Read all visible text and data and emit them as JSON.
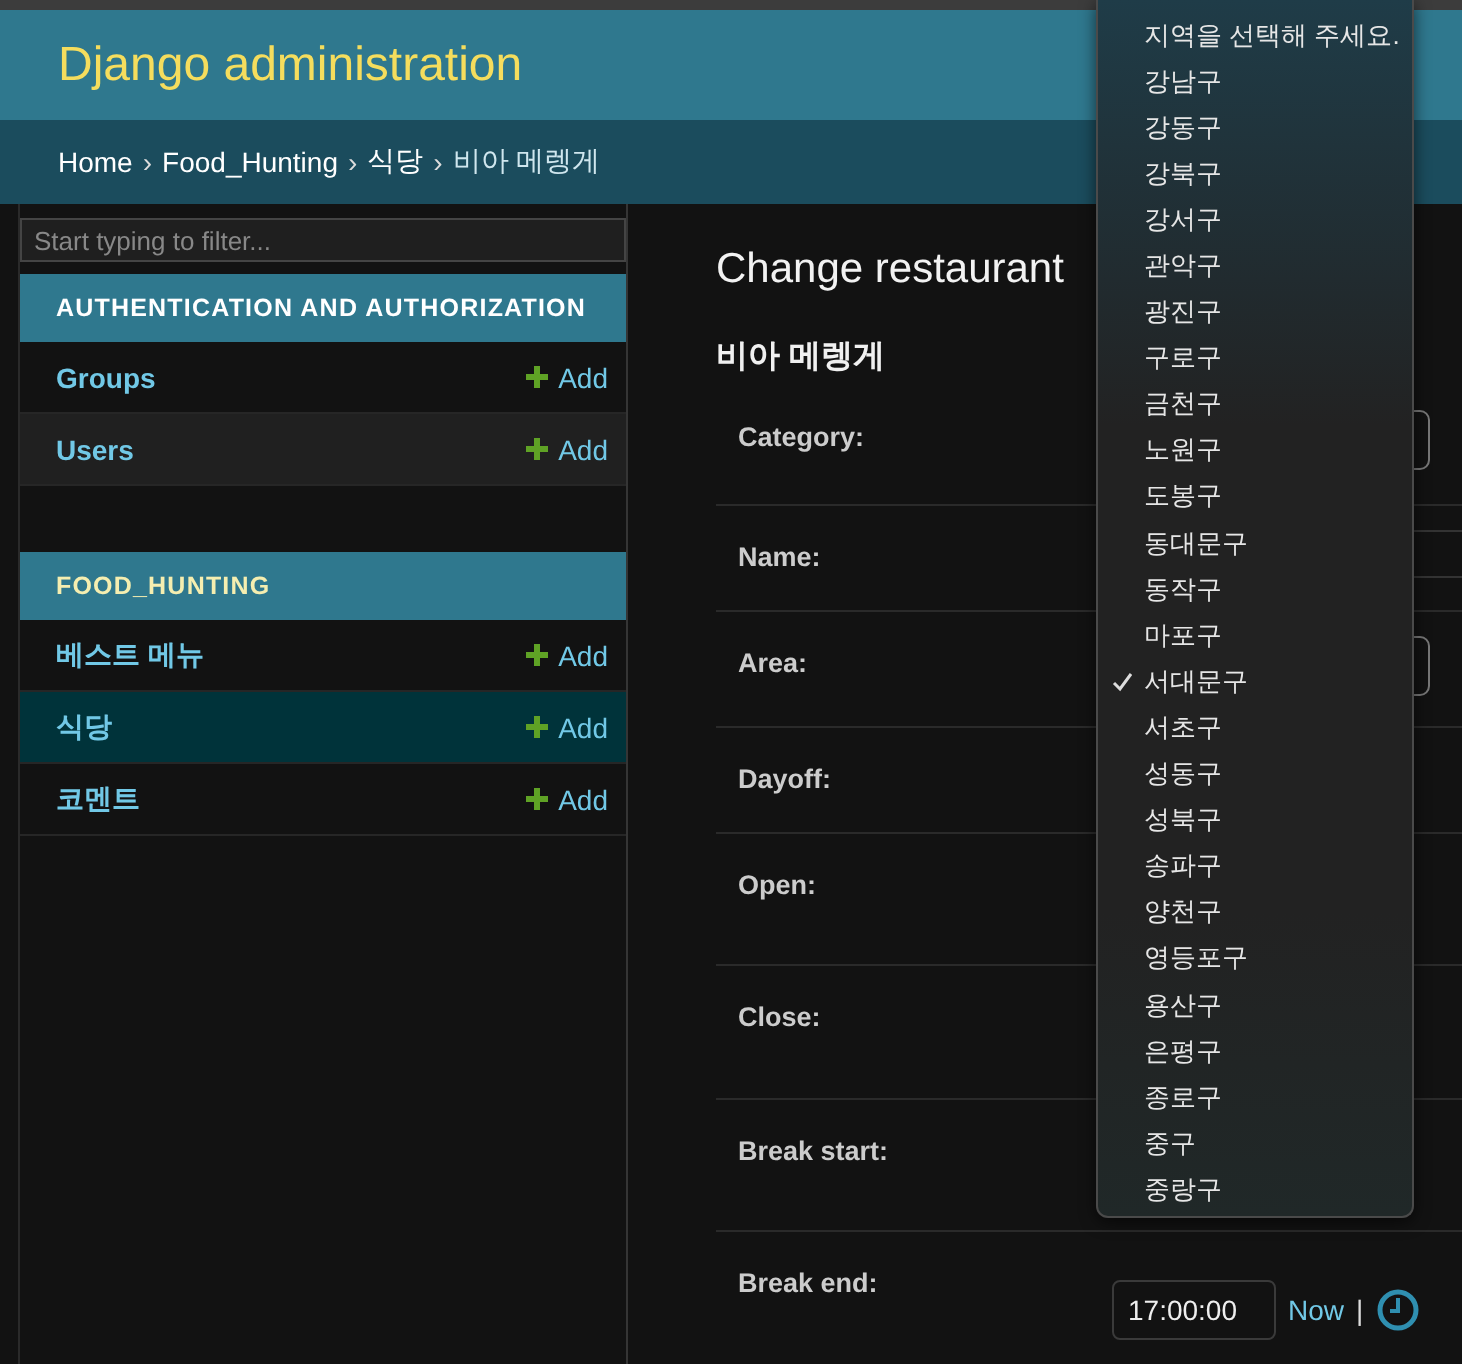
{
  "header": {
    "title": "Django administration"
  },
  "breadcrumbs": {
    "separator": "›",
    "items": [
      {
        "label": "Home",
        "current": false
      },
      {
        "label": "Food_Hunting",
        "current": false
      },
      {
        "label": "식당",
        "current": false
      },
      {
        "label": "비아 메렝게",
        "current": true
      }
    ]
  },
  "sidebar": {
    "filter_placeholder": "Start typing to filter...",
    "modules": [
      {
        "title": "AUTHENTICATION AND AUTHORIZATION",
        "highlight": false,
        "items": [
          {
            "label": "Groups",
            "add": "Add",
            "selected": false
          },
          {
            "label": "Users",
            "add": "Add",
            "selected": false
          }
        ]
      },
      {
        "title": "FOOD_HUNTING",
        "highlight": true,
        "items": [
          {
            "label": "베스트 메뉴",
            "add": "Add",
            "selected": false
          },
          {
            "label": "식당",
            "add": "Add",
            "selected": true
          },
          {
            "label": "코멘트",
            "add": "Add",
            "selected": false
          }
        ]
      }
    ]
  },
  "content": {
    "title": "Change restaurant",
    "subtitle": "비아 메렝게",
    "fields": [
      {
        "label": "Category:",
        "kind": "select"
      },
      {
        "label": "Name:",
        "kind": "text"
      },
      {
        "label": "Area:",
        "kind": "select"
      },
      {
        "label": "Dayoff:",
        "kind": "none"
      },
      {
        "label": "Open:",
        "kind": "none"
      },
      {
        "label": "Close:",
        "kind": "none"
      },
      {
        "label": "Break start:",
        "kind": "none"
      },
      {
        "label": "Break end:",
        "kind": "time",
        "value": "17:00:00",
        "now": "Now",
        "separator": "|"
      }
    ]
  },
  "dropdown": {
    "options": [
      {
        "label": "지역을 선택해 주세요.",
        "selected": false
      },
      {
        "label": "강남구",
        "selected": false
      },
      {
        "label": "강동구",
        "selected": false
      },
      {
        "label": "강북구",
        "selected": false
      },
      {
        "label": "강서구",
        "selected": false
      },
      {
        "label": "관악구",
        "selected": false
      },
      {
        "label": "광진구",
        "selected": false
      },
      {
        "label": "구로구",
        "selected": false
      },
      {
        "label": "금천구",
        "selected": false
      },
      {
        "label": "노원구",
        "selected": false
      },
      {
        "label": "도봉구",
        "selected": false
      },
      {
        "label": "동대문구",
        "selected": false
      },
      {
        "label": "동작구",
        "selected": false
      },
      {
        "label": "마포구",
        "selected": false
      },
      {
        "label": "서대문구",
        "selected": true
      },
      {
        "label": "서초구",
        "selected": false
      },
      {
        "label": "성동구",
        "selected": false
      },
      {
        "label": "성북구",
        "selected": false
      },
      {
        "label": "송파구",
        "selected": false
      },
      {
        "label": "양천구",
        "selected": false
      },
      {
        "label": "영등포구",
        "selected": false
      },
      {
        "label": "용산구",
        "selected": false
      },
      {
        "label": "은평구",
        "selected": false
      },
      {
        "label": "종로구",
        "selected": false
      },
      {
        "label": "중구",
        "selected": false
      },
      {
        "label": "중랑구",
        "selected": false
      }
    ]
  }
}
